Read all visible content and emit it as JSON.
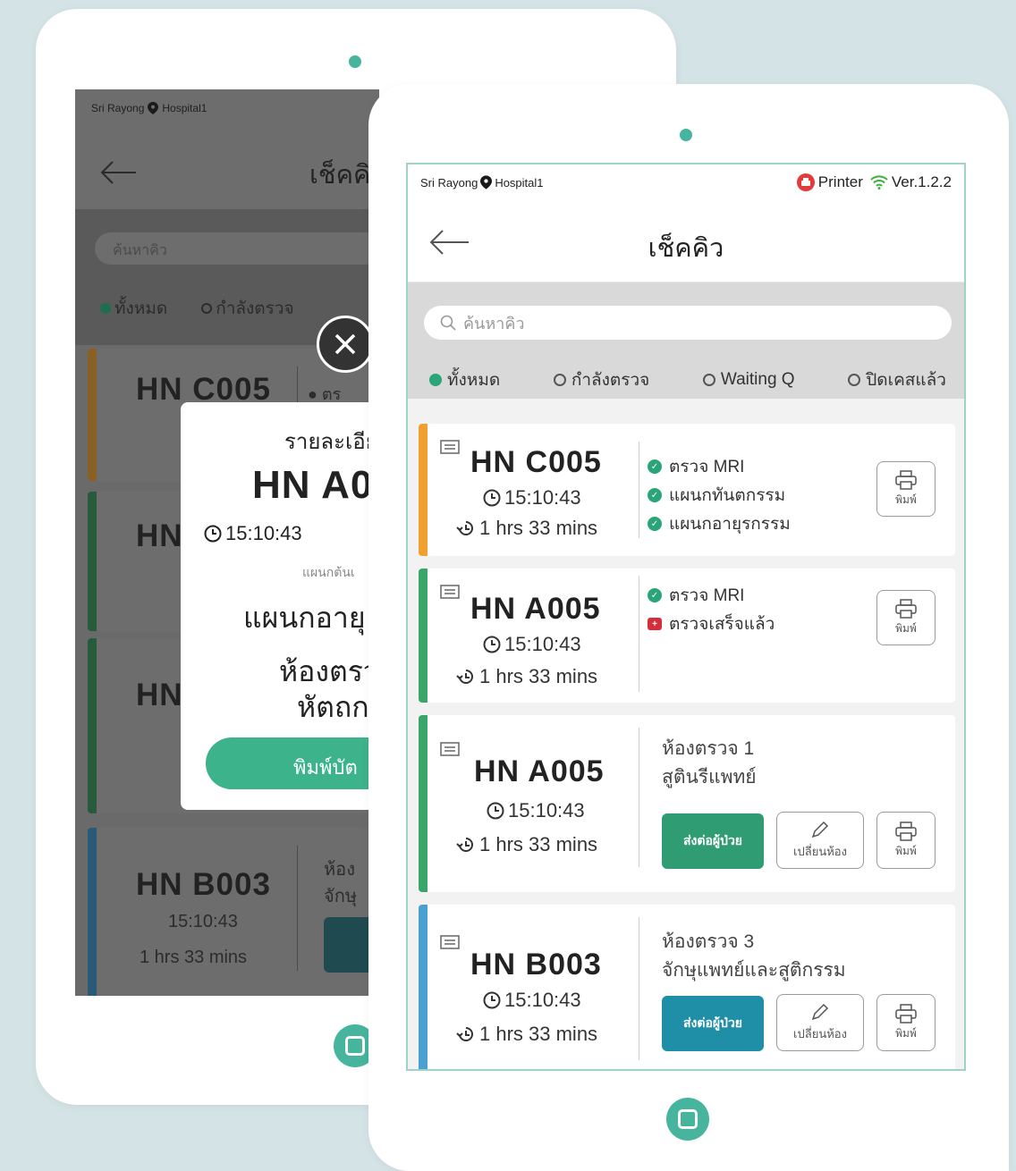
{
  "colors": {
    "accent": "#47b49d",
    "green_status": "#2aa57a",
    "bar_orange": "#f0a030",
    "bar_green": "#3aa66a",
    "bar_blue": "#4aa0d0",
    "send_green": "#2f9c74",
    "send_blue": "#1f8fa8",
    "alert_red": "#d62d3a"
  },
  "back_tablet": {
    "status": {
      "hospital_prefix": "Sri Rayong",
      "hospital_suffix": "Hospital1"
    },
    "title": "เช็คคิ",
    "search_placeholder": "ค้นหาคิว",
    "filters": [
      "ทั้งหมด",
      "กำลังตรวจ"
    ],
    "cards": [
      {
        "hn": "HN C005",
        "step": "ตร"
      },
      {
        "hn": "HN"
      },
      {
        "hn": "HN"
      },
      {
        "hn": "HN B003",
        "time": "15:10:43",
        "duration": "1 hrs 33 mins",
        "room_line1": "ห้อง",
        "room_line2": "จักษุ"
      }
    ],
    "modal": {
      "heading": "รายละเอีย",
      "hn": "HN A0",
      "time": "15:10:43",
      "dept_label": "แผนกต้นเ",
      "dept": "แผนกอายุ",
      "room_line1": "ห้องตรว",
      "room_line2": "หัตถก",
      "print_button": "พิมพ์บัต"
    }
  },
  "status": {
    "hospital_prefix": "Sri Rayong",
    "hospital_suffix": "Hospital1",
    "printer": "Printer",
    "version": "Ver.1.2.2"
  },
  "header": {
    "title": "เช็คคิว"
  },
  "search": {
    "placeholder": "ค้นหาคิว"
  },
  "filters": [
    {
      "label": "ทั้งหมด",
      "selected": true
    },
    {
      "label": "กำลังตรวจ",
      "selected": false
    },
    {
      "label": "Waiting Q",
      "selected": false
    },
    {
      "label": "ปิดเคสแล้ว",
      "selected": false
    }
  ],
  "cards": [
    {
      "hn": "HN C005",
      "time": "15:10:43",
      "duration": "1 hrs 33 mins",
      "steps": [
        {
          "label": "ตรวจ MRI",
          "status": "done"
        },
        {
          "label": "แผนกทันตกรรม",
          "status": "done"
        },
        {
          "label": "แผนกอายุรกรรม",
          "status": "done"
        }
      ],
      "print_label": "พิมพ์"
    },
    {
      "hn": "HN A005",
      "time": "15:10:43",
      "duration": "1 hrs 33 mins",
      "steps": [
        {
          "label": "ตรวจ MRI",
          "status": "done"
        },
        {
          "label": "ตรวจเสร็จแล้ว",
          "status": "finished"
        }
      ],
      "print_label": "พิมพ์"
    },
    {
      "hn": "HN A005",
      "time": "15:10:43",
      "duration": "1 hrs 33 mins",
      "room_line1": "ห้องตรวจ 1",
      "room_line2": "สูตินรีแพทย์",
      "send_label": "ส่งต่อผู้ป่วย",
      "change_room_label": "เปลี่ยนห้อง",
      "print_label": "พิมพ์"
    },
    {
      "hn": "HN B003",
      "time": "15:10:43",
      "duration": "1 hrs 33 mins",
      "room_line1": "ห้องตรวจ 3",
      "room_line2": "จักษุแพทย์และสูติกรรม",
      "send_label": "ส่งต่อผู้ป่วย",
      "change_room_label": "เปลี่ยนห้อง",
      "print_label": "พิมพ์"
    }
  ]
}
